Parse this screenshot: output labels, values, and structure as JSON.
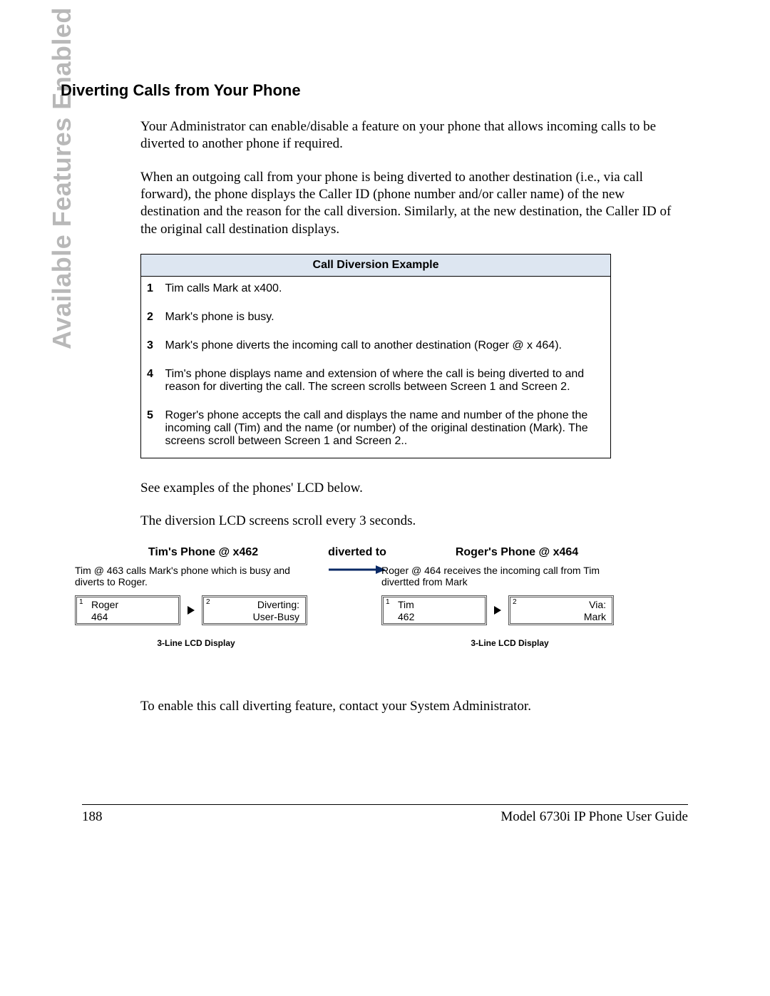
{
  "side_label": "Available Features Enabled by Administrators",
  "heading": "Diverting Calls from Your Phone",
  "paragraphs": {
    "p1": "Your Administrator can enable/disable a feature on your phone that allows incoming calls to be diverted to another phone if required.",
    "p2": "When an outgoing call from your phone is being diverted to another destination (i.e., via call forward), the phone displays the Caller ID (phone number and/or caller name) of the new destination and the reason for the call diversion. Similarly, at the new destination, the Caller ID of the original call destination displays.",
    "p3": "See examples of the phones' LCD below.",
    "p4": "The diversion LCD screens scroll every 3 seconds.",
    "p5": "To enable this call diverting feature, contact your System Administrator."
  },
  "table": {
    "header": "Call Diversion Example",
    "rows": [
      {
        "n": "1",
        "text": "Tim calls Mark at x400."
      },
      {
        "n": "2",
        "text": "Mark's phone is busy."
      },
      {
        "n": "3",
        "text": "Mark's phone diverts the incoming call to another destination (Roger @ x 464)."
      },
      {
        "n": "4",
        "text": "Tim's phone displays name and extension of where the call is being diverted to and reason for diverting the call. The screen scrolls between Screen 1 and Screen 2."
      },
      {
        "n": "5",
        "text": "Roger's phone accepts the call and displays the name and number of the phone the incoming call (Tim) and the name (or number) of the original destination (Mark). The screens scroll between Screen 1 and Screen 2.."
      }
    ]
  },
  "lcd": {
    "left": {
      "title": "Tim's Phone @ x462",
      "desc": "Tim @ 463 calls Mark's phone which is busy and diverts to Roger.",
      "screen1": {
        "num": "1",
        "line1": "Roger",
        "line2": "464"
      },
      "screen2": {
        "num": "2",
        "line1": "Diverting:",
        "line2": "User-Busy"
      },
      "caption": "3-Line LCD Display"
    },
    "mid_label": "diverted to",
    "right": {
      "title": "Roger's Phone @ x464",
      "desc": "Roger @ 464 receives the incoming call from Tim divertted from Mark",
      "screen1": {
        "num": "1",
        "line1": "Tim",
        "line2": "462"
      },
      "screen2": {
        "num": "2",
        "line1": "Via:",
        "line2": "Mark"
      },
      "caption": "3-Line LCD Display"
    }
  },
  "footer": {
    "page": "188",
    "title": "Model 6730i IP Phone User Guide"
  }
}
